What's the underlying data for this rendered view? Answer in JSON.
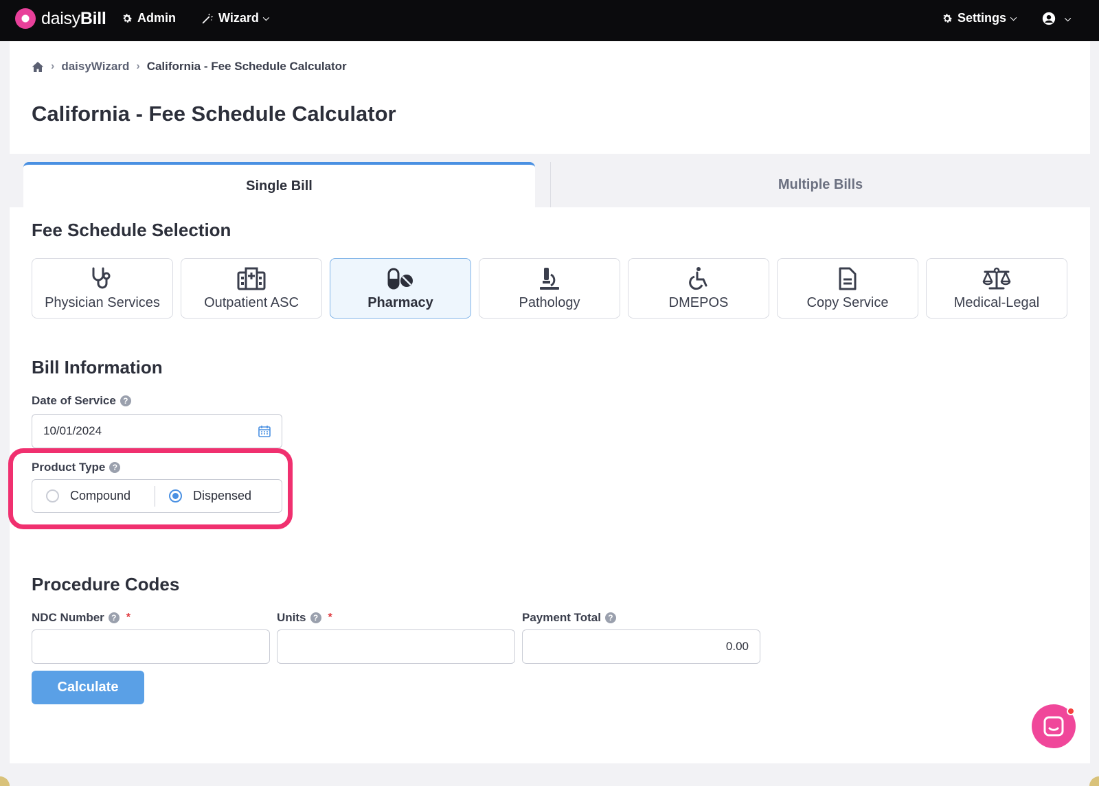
{
  "nav": {
    "brand_light": "daisy",
    "brand_bold": "Bill",
    "admin_label": "Admin",
    "wizard_label": "Wizard",
    "settings_label": "Settings"
  },
  "breadcrumb": {
    "items": [
      "daisyWizard",
      "California - Fee Schedule Calculator"
    ]
  },
  "page_title": "California - Fee Schedule Calculator",
  "tabs": [
    {
      "label": "Single Bill",
      "active": true
    },
    {
      "label": "Multiple Bills",
      "active": false
    }
  ],
  "fee_schedule": {
    "title": "Fee Schedule Selection",
    "options": [
      {
        "label": "Physician Services",
        "icon": "stethoscope-icon",
        "selected": false
      },
      {
        "label": "Outpatient ASC",
        "icon": "hospital-icon",
        "selected": false
      },
      {
        "label": "Pharmacy",
        "icon": "pills-icon",
        "selected": true
      },
      {
        "label": "Pathology",
        "icon": "microscope-icon",
        "selected": false
      },
      {
        "label": "DMEPOS",
        "icon": "wheelchair-icon",
        "selected": false
      },
      {
        "label": "Copy Service",
        "icon": "document-icon",
        "selected": false
      },
      {
        "label": "Medical-Legal",
        "icon": "scales-icon",
        "selected": false
      }
    ]
  },
  "bill_info": {
    "title": "Bill Information",
    "date_label": "Date of Service",
    "date_value": "10/01/2024",
    "product_type_label": "Product Type",
    "product_types": [
      {
        "label": "Compound",
        "checked": false
      },
      {
        "label": "Dispensed",
        "checked": true
      }
    ]
  },
  "procedure": {
    "title": "Procedure Codes",
    "ndc_label": "NDC Number",
    "ndc_value": "",
    "units_label": "Units",
    "units_value": "",
    "payment_label": "Payment Total",
    "payment_value": "0.00",
    "calculate_label": "Calculate"
  },
  "colors": {
    "accent": "#4a90e2",
    "highlight": "#f0306f",
    "chat": "#f0479a"
  }
}
